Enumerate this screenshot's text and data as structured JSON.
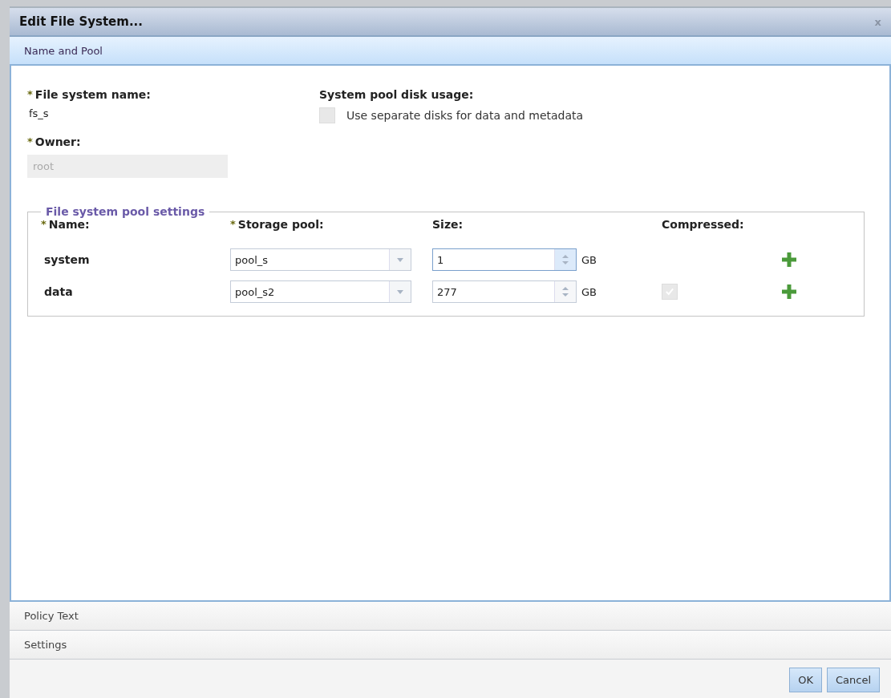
{
  "window": {
    "title": "Edit File System...",
    "close": "x"
  },
  "sections": [
    {
      "label": "Name and Pool",
      "selected": true
    },
    {
      "label": "Policy Text",
      "selected": false
    },
    {
      "label": "Settings",
      "selected": false
    }
  ],
  "name_field": {
    "mark": "*",
    "label": "File system name:",
    "value": "fs_s"
  },
  "owner_field": {
    "mark": "*",
    "label": "Owner:",
    "value": "root",
    "disabled": true
  },
  "disk_usage": {
    "label": "System pool disk usage:",
    "option": "Use separate disks for data and metadata",
    "checked": false,
    "disabled": true
  },
  "pool_settings": {
    "legend": "File system pool settings",
    "columns": [
      {
        "mark": "*",
        "label": "Name:"
      },
      {
        "mark": "*",
        "label": "Storage pool:"
      },
      {
        "label": "Size:"
      },
      {
        "label": "Compressed:"
      }
    ],
    "rows": [
      {
        "name": "system",
        "pool": "pool_s",
        "size": "1",
        "unit": "GB",
        "focused": true
      },
      {
        "name": "data",
        "pool": "pool_s2",
        "size": "277",
        "unit": "GB",
        "focused": false,
        "compressed": {
          "checked": true,
          "disabled": true
        }
      }
    ]
  },
  "buttons": [
    "OK",
    "Cancel"
  ]
}
